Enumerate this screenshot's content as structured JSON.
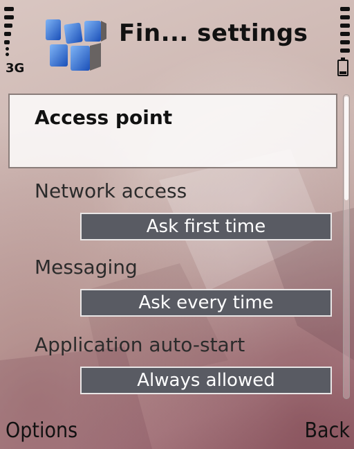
{
  "status": {
    "network_type": "3G",
    "signal_icon": "signal-strength-icon",
    "battery_icon": "battery-icon"
  },
  "header": {
    "title": "Fin... settings",
    "icon": "app-settings-icon"
  },
  "list": {
    "selected": {
      "label": "Access point",
      "value": ""
    },
    "items": [
      {
        "label": "Network access",
        "value": "Ask first time"
      },
      {
        "label": "Messaging",
        "value": "Ask every time"
      },
      {
        "label": "Application auto-start",
        "value": "Always allowed"
      }
    ]
  },
  "softkeys": {
    "left": "Options",
    "right": "Back"
  },
  "colors": {
    "value_box_bg": "#595b63",
    "selection_bg": "#ffffff"
  }
}
